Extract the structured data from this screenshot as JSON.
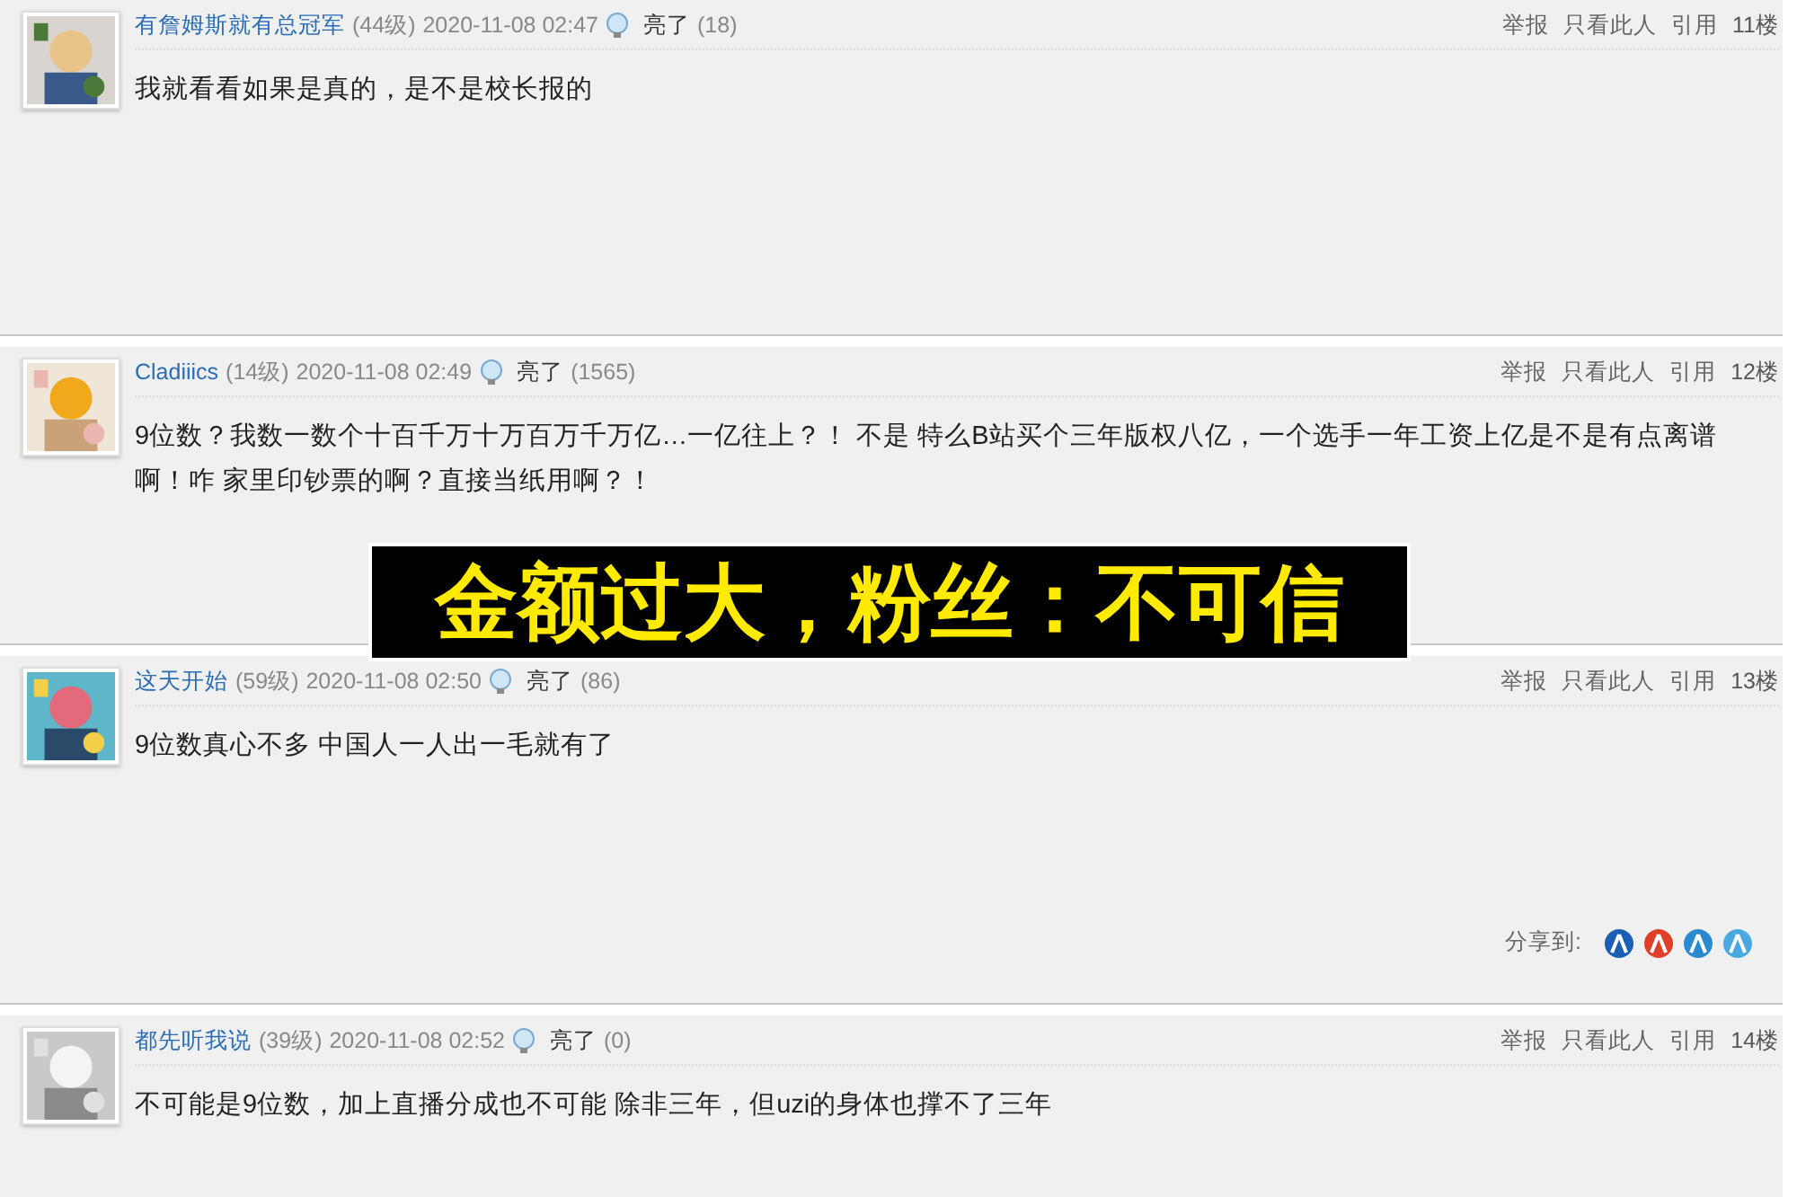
{
  "posts": [
    {
      "author": "有詹姆斯就有总冠军",
      "level": "(44级)",
      "time": "2020-11-08 02:47",
      "like_label": "亮了",
      "like_count": "(18)",
      "actions": [
        "举报",
        "只看此人",
        "引用"
      ],
      "floor": "11楼",
      "body": "我就看看如果是真的，是不是校长报的"
    },
    {
      "author": "Cladiiics",
      "level": "(14级)",
      "time": "2020-11-08 02:49",
      "like_label": "亮了",
      "like_count": "(1565)",
      "actions": [
        "举报",
        "只看此人",
        "引用"
      ],
      "floor": "12楼",
      "body": "9位数？我数一数个十百千万十万百万千万亿…一亿往上？！ 不是 特么B站买个三年版权八亿，一个选手一年工资上亿是不是有点离谱啊！咋 家里印钞票的啊？直接当纸用啊？！"
    },
    {
      "author": "这天开始",
      "level": "(59级)",
      "time": "2020-11-08 02:50",
      "like_label": "亮了",
      "like_count": "(86)",
      "actions": [
        "举报",
        "只看此人",
        "引用"
      ],
      "floor": "13楼",
      "body": "9位数真心不多 中国人一人出一毛就有了",
      "share_label": "分享到:"
    },
    {
      "author": "都先听我说",
      "level": "(39级)",
      "time": "2020-11-08 02:52",
      "like_label": "亮了",
      "like_count": "(0)",
      "actions": [
        "举报",
        "只看此人",
        "引用"
      ],
      "floor": "14楼",
      "body": "不可能是9位数，加上直播分成也不可能 除非三年，但uzi的身体也撑不了三年"
    }
  ],
  "caption": "金额过大，粉丝：不可信"
}
